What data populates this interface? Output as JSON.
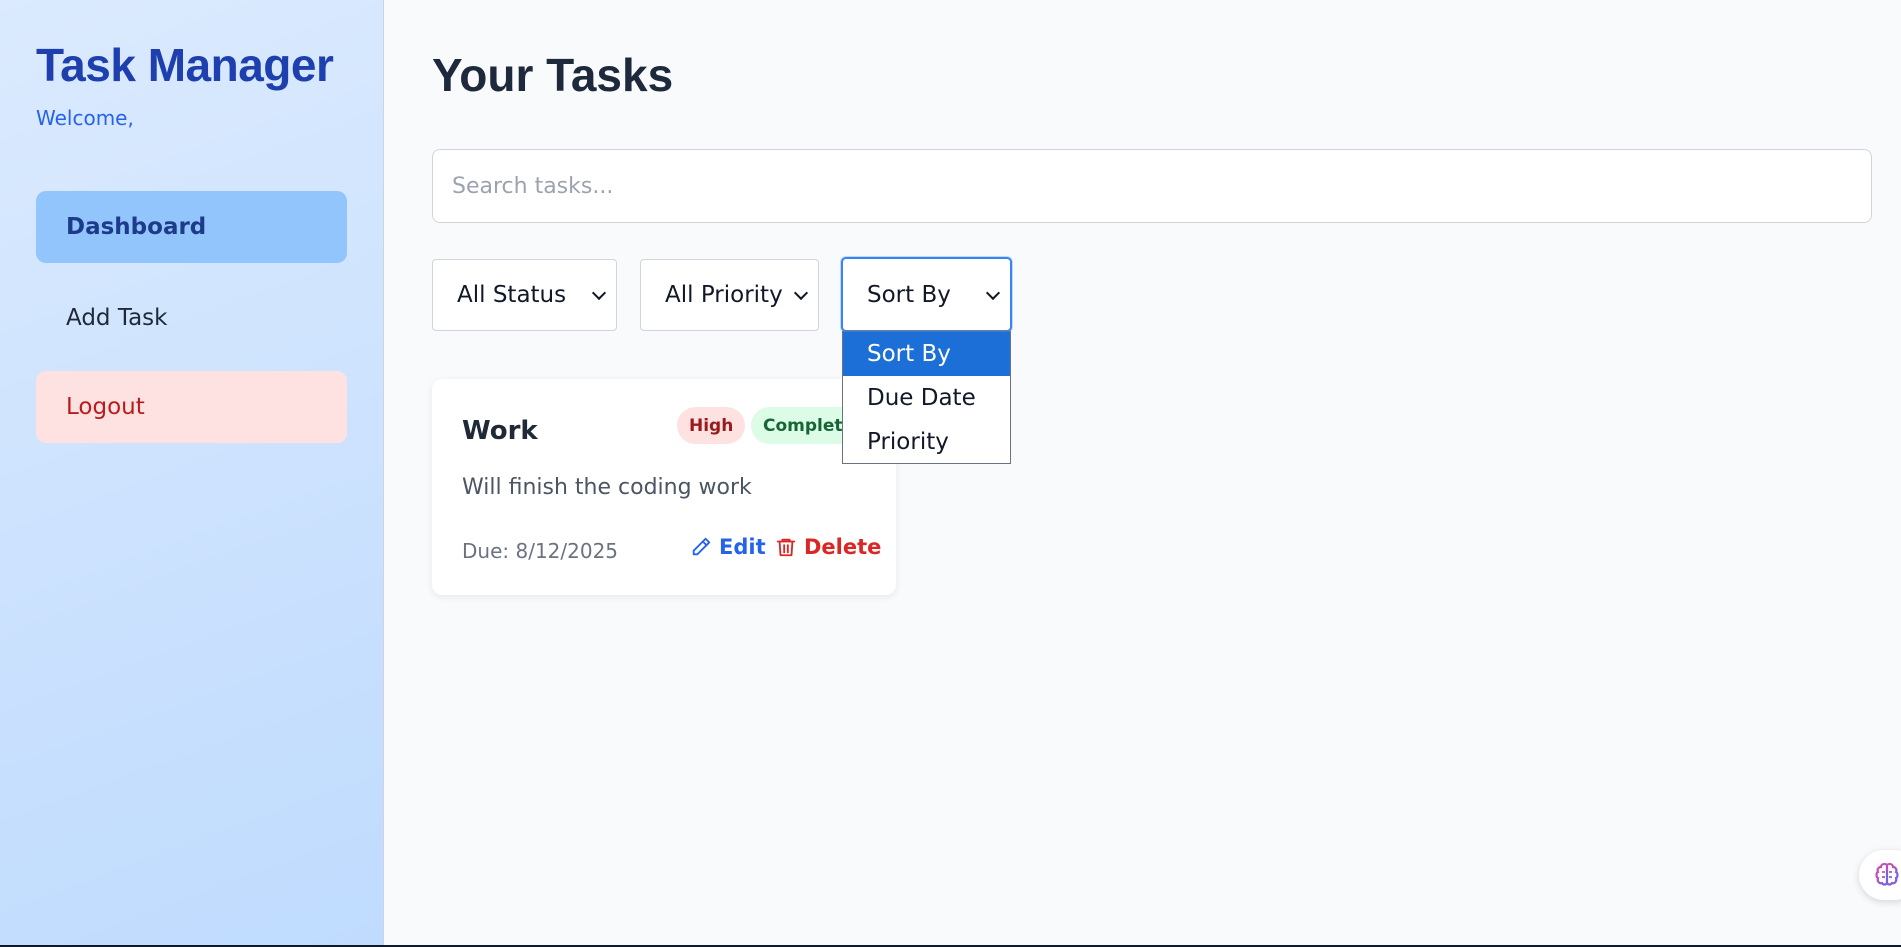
{
  "sidebar": {
    "brand": "Task Manager",
    "welcome": "Welcome,",
    "nav": {
      "dashboard": "Dashboard",
      "add_task": "Add Task",
      "logout": "Logout"
    }
  },
  "main": {
    "title": "Your Tasks",
    "search": {
      "placeholder": "Search tasks...",
      "value": ""
    },
    "filters": {
      "status": {
        "selected": "All Status"
      },
      "priority": {
        "selected": "All Priority"
      },
      "sort": {
        "selected": "Sort By",
        "open": true,
        "options": [
          "Sort By",
          "Due Date",
          "Priority"
        ]
      }
    },
    "tasks": [
      {
        "title": "Work",
        "priority": "High",
        "status": "Completed",
        "description": "Will finish the coding work",
        "due": "Due: 8/12/2025",
        "edit_label": "Edit",
        "delete_label": "Delete"
      }
    ]
  },
  "icons": {
    "edit": "pencil-icon",
    "delete": "trash-icon",
    "chevron": "chevron-down-icon",
    "assistant": "brain-icon"
  },
  "colors": {
    "brand": "#1e40af",
    "accent": "#2563eb",
    "danger": "#dc2626",
    "sidebar_active": "#93c5fd",
    "logout_bg": "#fee2e2",
    "dropdown_selected": "#1d6fd8"
  }
}
